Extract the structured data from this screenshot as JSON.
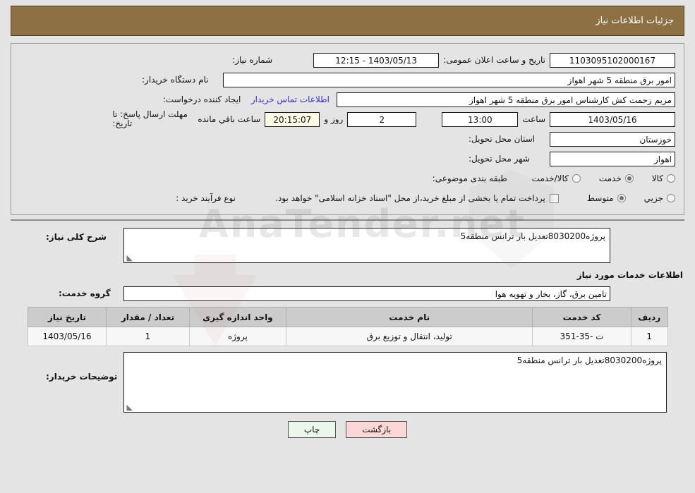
{
  "header": {
    "title": "جزئیات اطلاعات نیاز",
    "bg_color": "#8d7044",
    "text_color": "#ffffff"
  },
  "watermark": {
    "text": "AnaTender.net"
  },
  "summary": {
    "need_number": {
      "label": "شماره نیاز:",
      "value": "1103095102000167"
    },
    "public_announce": {
      "label": "تاریخ و ساعت اعلان عمومی:",
      "value": "1403/05/13 - 12:15"
    },
    "buyer_org": {
      "label": "نام دستگاه خریدار:",
      "value": "امور برق منطقه 5 شهر اهواز"
    },
    "creator": {
      "label": "ایجاد کننده درخواست:",
      "value": "مریم زحمت کش کارشناس امور برق منطقه 5 شهر اهواز"
    },
    "contact_link": "اطلاعات تماس خریدار",
    "deadline": {
      "label": "مهلت ارسال پاسخ: تا تاریخ:",
      "date": "1403/05/16",
      "time_label": "ساعت",
      "time": "13:00",
      "days": "2",
      "days_suffix": "روز و",
      "countdown": "20:15:07",
      "countdown_suffix": "ساعت باقي مانده"
    },
    "province": {
      "label": "استان محل تحویل:",
      "value": "خوزستان"
    },
    "city": {
      "label": "شهر محل تحویل:",
      "value": "اهواز"
    },
    "category": {
      "label": "طبقه بندی موضوعی:",
      "options": [
        {
          "label": "کالا",
          "selected": false
        },
        {
          "label": "خدمت",
          "selected": true
        },
        {
          "label": "کالا/خدمت",
          "selected": false
        }
      ]
    },
    "purchase_process": {
      "label": "نوع فرآیند خرید :",
      "options": [
        {
          "label": "جزیي",
          "selected": false
        },
        {
          "label": "متوسط",
          "selected": true
        }
      ],
      "treasury_note": "پرداخت تمام یا بخشی از مبلغ خرید،از محل \"اسناد خزانه اسلامی\" خواهد بود.",
      "treasury_checked": false
    }
  },
  "description": {
    "label": "شرح کلی نیاز:",
    "value": "پروژه8030200تعدیل بار ترانس منطقه5"
  },
  "services_section": {
    "title": "اطلاعات خدمات مورد نیاز",
    "service_group": {
      "label": "گروه خدمت:",
      "value": "تامین برق، گاز، بخار و تهویه هوا"
    },
    "table": {
      "columns": [
        "ردیف",
        "کد خدمت",
        "نام خدمت",
        "واحد اندازه گیری",
        "تعداد / مقدار",
        "تاریخ نیاز"
      ],
      "rows": [
        {
          "radif": "1",
          "code": "ت -35-351",
          "name": "تولید، انتقال و توزیع برق",
          "unit": "پروژه",
          "qty": "1",
          "date": "1403/05/16"
        }
      ]
    }
  },
  "buyer_notes": {
    "label": "توضیحات خریدار:",
    "value": "پروژه8030200تعدیل بار ترانس منطقه5"
  },
  "footer": {
    "print_label": "چاپ",
    "back_label": "بازگشت"
  }
}
